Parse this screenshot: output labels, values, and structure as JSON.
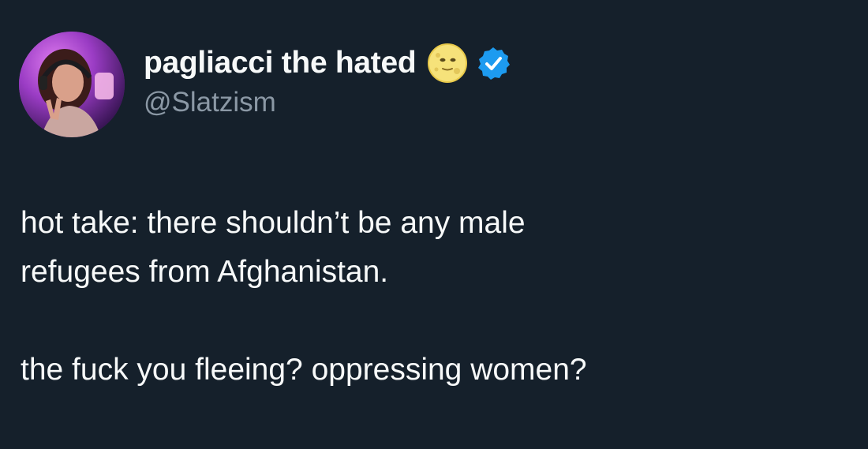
{
  "author": {
    "display_name": "pagliacci the hated",
    "handle": "@Slatzism",
    "name_emoji_icon": "moon-face-icon",
    "verified_icon": "verified-badge-icon",
    "avatar": "profile-photo"
  },
  "tweet": {
    "paragraph_1": "hot take: there shouldn’t be any male\nrefugees from Afghanistan.",
    "paragraph_2": "the fuck you fleeing? oppressing women?"
  },
  "colors": {
    "background": "#15202b",
    "text_primary": "#f7f9f9",
    "text_secondary": "#8b98a5",
    "verified_blue": "#1d9bf0"
  }
}
